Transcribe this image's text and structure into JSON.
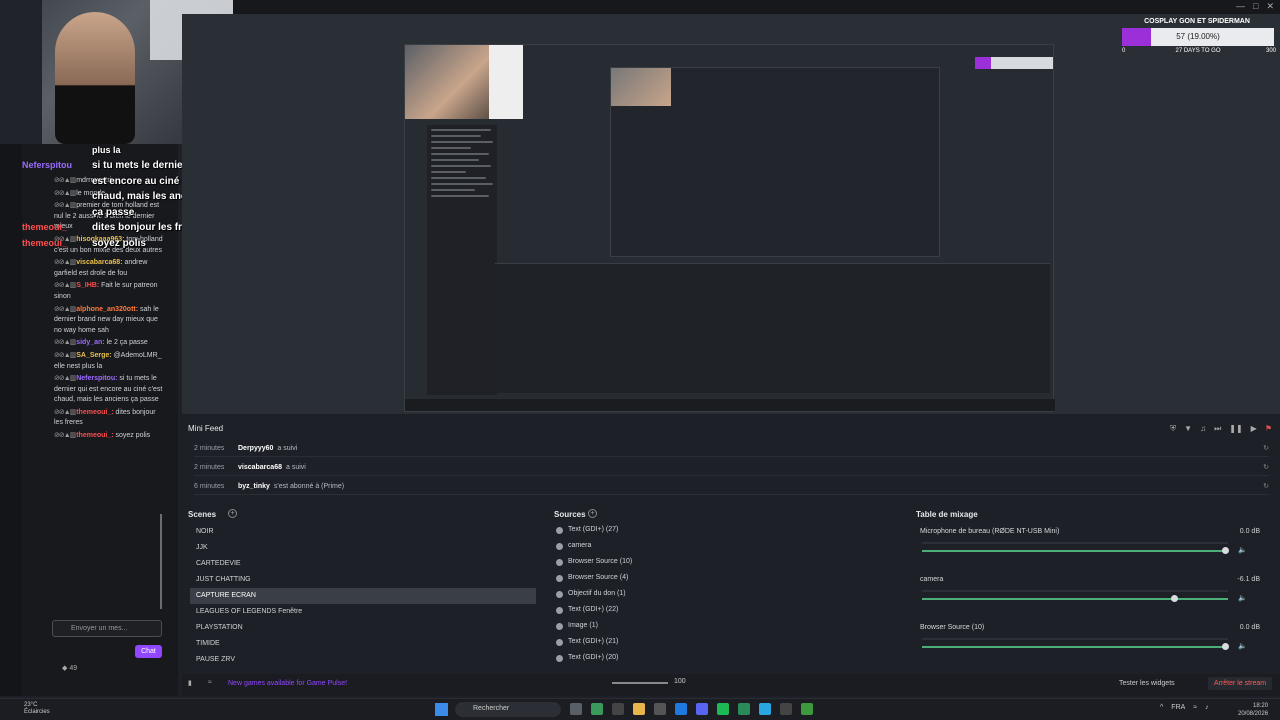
{
  "stream_overlay": {
    "chat_overlay_small": "plus la",
    "chat_overlay_lines": [
      "si tu mets le dernier qui",
      "est encore au ciné c'est",
      "chaud, mais les anciens",
      "ça passe",
      "dites bonjour les freres",
      "soyez polis"
    ],
    "overlay_names": [
      "Neferspitou",
      "",
      "",
      "",
      "themeoui_",
      "themeoui_"
    ]
  },
  "goal": {
    "title": "COSPLAY GON ET SPIDERMAN",
    "value": "57 (19.00%)",
    "progress": 0.19,
    "min": "0",
    "max": "300",
    "days": "27 DAYS TO GO",
    "fill_color": "#9b30d9"
  },
  "chat": {
    "messages": [
      {
        "user": "",
        "text": "mdrrr w stri..."
      },
      {
        "user": "",
        "text": "le monde"
      },
      {
        "user": "",
        "text": "premier de tom holland est nul le 2 aussi le 3 bien le dernier mieux"
      },
      {
        "user": "hisookaaa963:",
        "color": "#e8c04b",
        "text": "tom holland c'est un bon mixte des deux autres"
      },
      {
        "user": "viscabarca68:",
        "color": "#e8c04b",
        "text": "andrew garfield est drole de fou"
      },
      {
        "user": "S_IHB:",
        "color": "#ff4d4d",
        "text": "Fait le sur patreon sinon"
      },
      {
        "user": "alphone_an320ott:",
        "color": "#ff7a3c",
        "text": "sah le dernier brand new day mieux que no way home sah"
      },
      {
        "user": "sidy_an:",
        "color": "#9b6bff",
        "text": "le 2 ça passe"
      },
      {
        "user": "SA_Serge:",
        "color": "#e8c04b",
        "text": "@AdemoLMR_ elle nest plus la"
      },
      {
        "user": "Neferspitou:",
        "color": "#9b6bff",
        "text": "si tu mets le dernier qui est encore au ciné c'est chaud, mais les anciens ça passe"
      },
      {
        "user": "themeoui_:",
        "color": "#ff4d4d",
        "text": "dites bonjour les freres"
      },
      {
        "user": "themeoui_:",
        "color": "#ff4d4d",
        "text": "soyez polis"
      }
    ],
    "input_placeholder": "Envoyer un mes...",
    "chat_button": "Chat",
    "viewer_count": "49"
  },
  "minifeed": {
    "title": "Mini Feed",
    "rows": [
      {
        "time": "2 minutes",
        "user": "Derpyyy60",
        "action": "a suivi"
      },
      {
        "time": "2 minutes",
        "user": "viscabarca68",
        "action": "a suivi"
      },
      {
        "time": "6 minutes",
        "user": "byz_tinky",
        "action": "s'est abonné à (Prime)"
      }
    ]
  },
  "scenes": {
    "title": "Scenes",
    "items": [
      "NOIR",
      "JJK",
      "CARTEDEVIE",
      "JUST CHATTING",
      "CAPTURE ECRAN",
      "LEAGUES OF LEGENDS Fenêtre",
      "PLAYSTATION",
      "TIMIDE",
      "PAUSE ZRV"
    ],
    "active_index": 4
  },
  "sources": {
    "title": "Sources",
    "items": [
      "Text (GDI+) (27)",
      "camera",
      "Browser Source (10)",
      "Browser Source (4)",
      "Objectif du don (1)",
      "Text (GDI+) (22)",
      "Image (1)",
      "Text (GDI+) (21)",
      "Text (GDI+) (20)"
    ]
  },
  "mixer": {
    "title": "Table de mixage",
    "channels": [
      {
        "name": "Microphone de bureau (RØDE NT-USB Mini)",
        "db": "0.0 dB",
        "level": 1.0
      },
      {
        "name": "camera",
        "db": "-6.1 dB",
        "level": 0.83
      },
      {
        "name": "Browser Source (10)",
        "db": "0.0 dB",
        "level": 1.0
      }
    ]
  },
  "statusbar": {
    "news": "New games available for Game Pulse!",
    "volume": "100",
    "test_widgets": "Tester les widgets",
    "stop_stream": "Arrêter le stream"
  },
  "taskbar": {
    "weather_temp": "23°C",
    "weather_desc": "Éclaircies",
    "search": "Rechercher",
    "lang": "FRA",
    "time": "18:20",
    "date": "20/08/2026"
  }
}
